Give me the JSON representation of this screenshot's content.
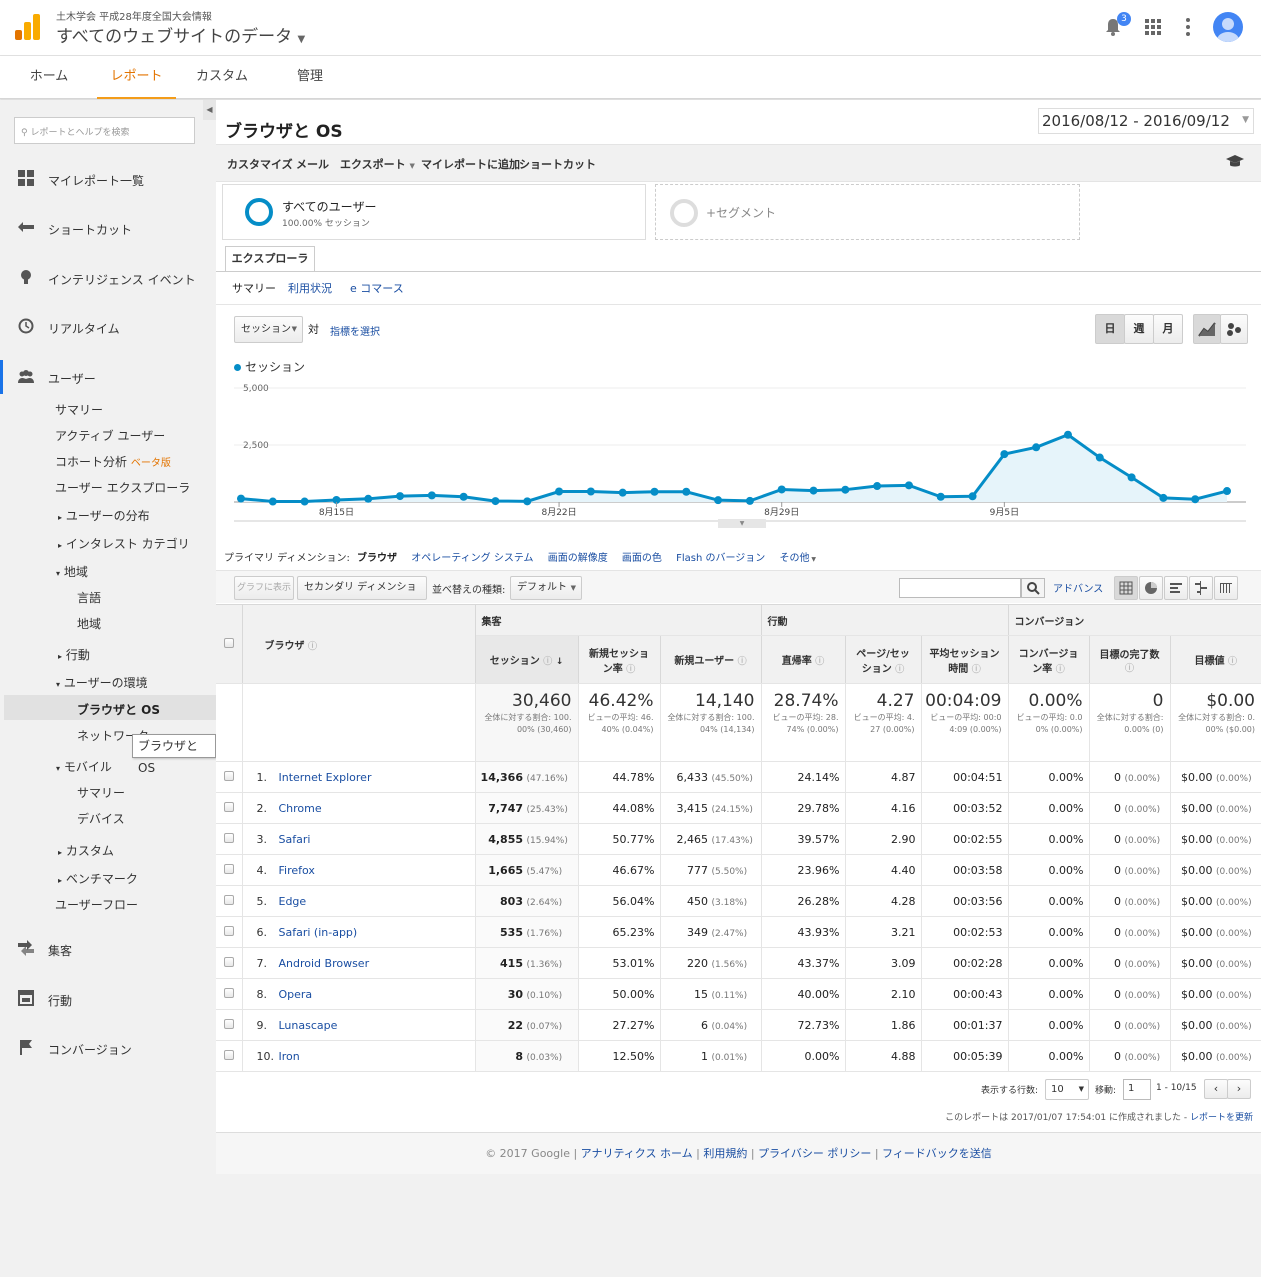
{
  "app": {
    "org": "土木学会 平成28年度全国大会情報",
    "property": "すべてのウェブサイトのデータ",
    "notif_count": "3"
  },
  "nav": {
    "tabs": [
      "ホーム",
      "レポート",
      "カスタム",
      "管理"
    ]
  },
  "sidebar": {
    "search_placeholder": "レポートとヘルプを検索",
    "main": [
      "マイレポート一覧",
      "ショートカット",
      "インテリジェンス イベント",
      "リアルタイム",
      "ユーザー"
    ],
    "users": {
      "summary": "サマリー",
      "active": "アクティブ ユーザー",
      "cohort": "コホート分析",
      "beta": "ベータ版",
      "explorer": "ユーザー エクスプローラ",
      "demographics": "ユーザーの分布",
      "interests": "インタレスト カテゴリ",
      "geo": "地域",
      "language": "言語",
      "location": "地域",
      "behavior": "行動",
      "tech": "ユーザーの環境",
      "browser_os": "ブラウザと OS",
      "network": "ネットワーク",
      "mobile": "モバイル",
      "mobile_summary": "サマリー",
      "devices": "デバイス",
      "custom": "カスタム",
      "benchmark": "ベンチマーク",
      "flow": "ユーザーフロー"
    },
    "bottom": [
      "集客",
      "行動",
      "コンバージョン"
    ],
    "tooltip": "ブラウザと OS"
  },
  "report": {
    "title": "ブラウザと OS",
    "date_range": "2016/08/12 - 2016/09/12",
    "toolbar": [
      "カスタマイズ",
      "メール",
      "エクスポート",
      "マイレポートに追加",
      "ショートカット"
    ],
    "segment": {
      "name": "すべてのユーザー",
      "sub": "100.00% セッション",
      "add": "+セグメント"
    },
    "explorer_tab": "エクスプローラ",
    "subtabs": [
      "サマリー",
      "利用状況",
      "e コマース"
    ],
    "metric_select": "セッション",
    "vs": "対",
    "choose_metric": "指標を選択",
    "period_buttons": [
      "日",
      "週",
      "月"
    ],
    "legend": "セッション",
    "primary_dim_label": "プライマリ ディメンション:",
    "primary_dims": [
      "ブラウザ",
      "オペレーティング システム",
      "画面の解像度",
      "画面の色",
      "Flash のバージョン",
      "その他"
    ],
    "controls": {
      "plot": "グラフに表示",
      "secondary": "セカンダリ ディメンション",
      "sort_label": "並べ替えの種類:",
      "sort_value": "デフォルト",
      "advanced": "アドバンス"
    },
    "table_groups": [
      "集客",
      "行動",
      "コンバージョン"
    ],
    "columns": [
      "ブラウザ",
      "セッション",
      "新規セッション率",
      "新規ユーザー",
      "直帰率",
      "ページ/セッション",
      "平均セッション時間",
      "コンバージョン率",
      "目標の完了数",
      "目標値"
    ],
    "totals": [
      {
        "v": "30,460",
        "sub": "全体に対する割合: 100.00% (30,460)"
      },
      {
        "v": "46.42%",
        "sub": "ビューの平均: 46.40% (0.04%)"
      },
      {
        "v": "14,140",
        "sub": "全体に対する割合: 100.04% (14,134)"
      },
      {
        "v": "28.74%",
        "sub": "ビューの平均: 28.74% (0.00%)"
      },
      {
        "v": "4.27",
        "sub": "ビューの平均: 4.27 (0.00%)"
      },
      {
        "v": "00:04:09",
        "sub": "ビューの平均: 00:04:09 (0.00%)"
      },
      {
        "v": "0.00%",
        "sub": "ビューの平均: 0.00% (0.00%)"
      },
      {
        "v": "0",
        "sub": "全体に対する割合: 0.00% (0)"
      },
      {
        "v": "$0.00",
        "sub": "全体に対する割合: 0.00% ($0.00)"
      }
    ],
    "rows": [
      {
        "n": "1.",
        "name": "Internet Explorer",
        "s": "14,366",
        "sp": "(47.16%)",
        "nr": "44.78%",
        "nu": "6,433",
        "nup": "(45.50%)",
        "br": "24.14%",
        "pps": "4.87",
        "dur": "00:04:51",
        "cr": "0.00%",
        "gc": "0",
        "gcp": "(0.00%)",
        "gv": "$0.00",
        "gvp": "(0.00%)"
      },
      {
        "n": "2.",
        "name": "Chrome",
        "s": "7,747",
        "sp": "(25.43%)",
        "nr": "44.08%",
        "nu": "3,415",
        "nup": "(24.15%)",
        "br": "29.78%",
        "pps": "4.16",
        "dur": "00:03:52",
        "cr": "0.00%",
        "gc": "0",
        "gcp": "(0.00%)",
        "gv": "$0.00",
        "gvp": "(0.00%)"
      },
      {
        "n": "3.",
        "name": "Safari",
        "s": "4,855",
        "sp": "(15.94%)",
        "nr": "50.77%",
        "nu": "2,465",
        "nup": "(17.43%)",
        "br": "39.57%",
        "pps": "2.90",
        "dur": "00:02:55",
        "cr": "0.00%",
        "gc": "0",
        "gcp": "(0.00%)",
        "gv": "$0.00",
        "gvp": "(0.00%)"
      },
      {
        "n": "4.",
        "name": "Firefox",
        "s": "1,665",
        "sp": "(5.47%)",
        "nr": "46.67%",
        "nu": "777",
        "nup": "(5.50%)",
        "br": "23.96%",
        "pps": "4.40",
        "dur": "00:03:58",
        "cr": "0.00%",
        "gc": "0",
        "gcp": "(0.00%)",
        "gv": "$0.00",
        "gvp": "(0.00%)"
      },
      {
        "n": "5.",
        "name": "Edge",
        "s": "803",
        "sp": "(2.64%)",
        "nr": "56.04%",
        "nu": "450",
        "nup": "(3.18%)",
        "br": "26.28%",
        "pps": "4.28",
        "dur": "00:03:56",
        "cr": "0.00%",
        "gc": "0",
        "gcp": "(0.00%)",
        "gv": "$0.00",
        "gvp": "(0.00%)"
      },
      {
        "n": "6.",
        "name": "Safari (in-app)",
        "s": "535",
        "sp": "(1.76%)",
        "nr": "65.23%",
        "nu": "349",
        "nup": "(2.47%)",
        "br": "43.93%",
        "pps": "3.21",
        "dur": "00:02:53",
        "cr": "0.00%",
        "gc": "0",
        "gcp": "(0.00%)",
        "gv": "$0.00",
        "gvp": "(0.00%)"
      },
      {
        "n": "7.",
        "name": "Android Browser",
        "s": "415",
        "sp": "(1.36%)",
        "nr": "53.01%",
        "nu": "220",
        "nup": "(1.56%)",
        "br": "43.37%",
        "pps": "3.09",
        "dur": "00:02:28",
        "cr": "0.00%",
        "gc": "0",
        "gcp": "(0.00%)",
        "gv": "$0.00",
        "gvp": "(0.00%)"
      },
      {
        "n": "8.",
        "name": "Opera",
        "s": "30",
        "sp": "(0.10%)",
        "nr": "50.00%",
        "nu": "15",
        "nup": "(0.11%)",
        "br": "40.00%",
        "pps": "2.10",
        "dur": "00:00:43",
        "cr": "0.00%",
        "gc": "0",
        "gcp": "(0.00%)",
        "gv": "$0.00",
        "gvp": "(0.00%)"
      },
      {
        "n": "9.",
        "name": "Lunascape",
        "s": "22",
        "sp": "(0.07%)",
        "nr": "27.27%",
        "nu": "6",
        "nup": "(0.04%)",
        "br": "72.73%",
        "pps": "1.86",
        "dur": "00:01:37",
        "cr": "0.00%",
        "gc": "0",
        "gcp": "(0.00%)",
        "gv": "$0.00",
        "gvp": "(0.00%)"
      },
      {
        "n": "10.",
        "name": "Iron",
        "s": "8",
        "sp": "(0.03%)",
        "nr": "12.50%",
        "nu": "1",
        "nup": "(0.01%)",
        "br": "0.00%",
        "pps": "4.88",
        "dur": "00:05:39",
        "cr": "0.00%",
        "gc": "0",
        "gcp": "(0.00%)",
        "gv": "$0.00",
        "gvp": "(0.00%)"
      }
    ],
    "pager": {
      "rows_label": "表示する行数:",
      "rows_value": "10",
      "goto_label": "移動:",
      "goto_value": "1",
      "range": "1 - 10/15"
    },
    "created": "このレポートは 2017/01/07 17:54:01 に作成されました - ",
    "refresh": "レポートを更新"
  },
  "chart_data": {
    "type": "area",
    "series": [
      {
        "name": "セッション",
        "values": [
          150,
          20,
          20,
          90,
          140,
          260,
          290,
          230,
          40,
          30,
          460,
          460,
          410,
          450,
          450,
          80,
          50,
          550,
          500,
          540,
          700,
          730,
          230,
          250,
          2100,
          2400,
          2950,
          1950,
          1080,
          180,
          120,
          480
        ]
      }
    ],
    "x_tick_labels": [
      "8月15日",
      "8月22日",
      "8月29日",
      "9月5日"
    ],
    "y_tick_labels": [
      "2,500",
      "5,000"
    ],
    "ylim": [
      0,
      5000
    ],
    "color": "#058dc7"
  },
  "footer": {
    "copyright": "© 2017 Google",
    "links": [
      "アナリティクス ホーム",
      "利用規約",
      "プライバシー ポリシー",
      "フィードバックを送信"
    ]
  }
}
